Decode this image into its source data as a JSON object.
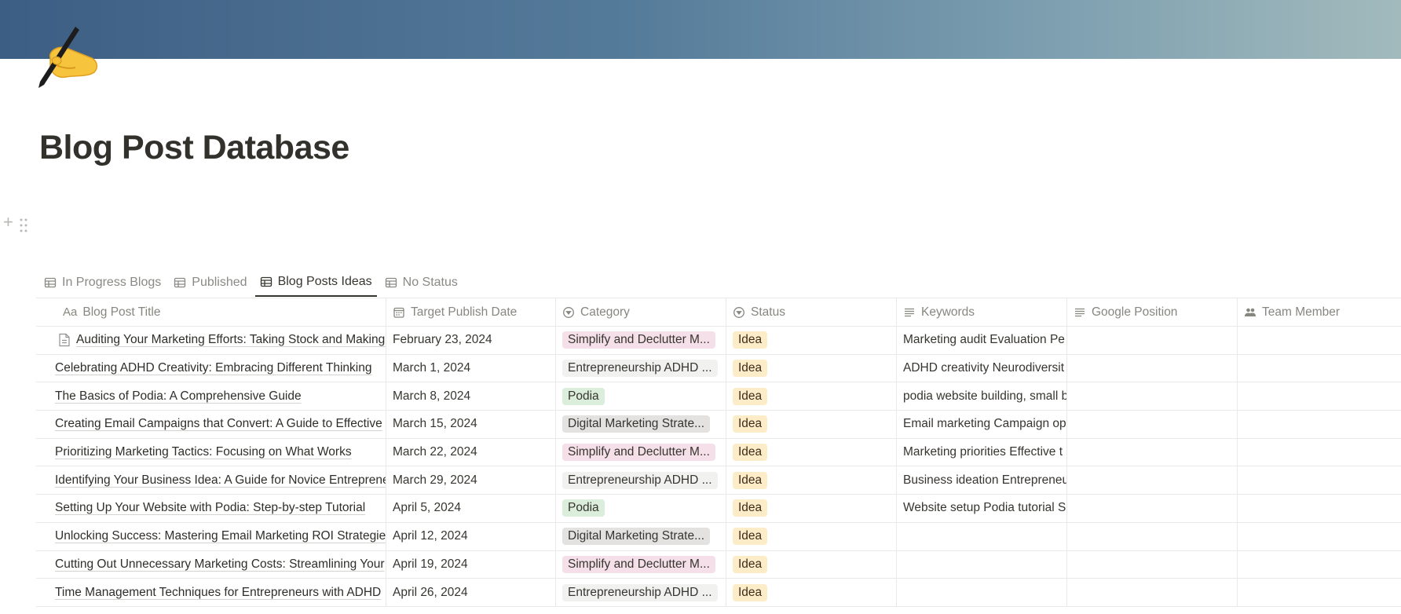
{
  "page": {
    "title": "Blog Post Database",
    "icon": "writing-hand-icon"
  },
  "tabs": [
    {
      "label": "In Progress Blogs",
      "active": false
    },
    {
      "label": "Published",
      "active": false
    },
    {
      "label": "Blog Posts Ideas",
      "active": true
    },
    {
      "label": "No Status",
      "active": false
    }
  ],
  "columns": [
    "Blog Post Title",
    "Target Publish Date",
    "Category",
    "Status",
    "Keywords",
    "Google Position",
    "Team Member"
  ],
  "category_colors": {
    "Simplify and Declutter M...": "#f5e0e9",
    "Entrepreneurship ADHD ...": "#f1f1ef",
    "Podia": "#dbeddb",
    "Digital Marketing Strate...": "#e3e2e0"
  },
  "status_color": "#fdecc8",
  "rows": [
    {
      "title": "Auditing Your Marketing Efforts: Taking Stock and Making Changes",
      "date": "February 23, 2024",
      "category": "Simplify and Declutter M...",
      "status": "Idea",
      "keywords": "Marketing audit Evaluation Pe"
    },
    {
      "title": "Celebrating ADHD Creativity: Embracing Different Thinking",
      "date": "March 1, 2024",
      "category": "Entrepreneurship ADHD ...",
      "status": "Idea",
      "keywords": "ADHD creativity Neurodiversit"
    },
    {
      "title": "The Basics of Podia: A Comprehensive Guide",
      "date": "March 8, 2024",
      "category": "Podia",
      "status": "Idea",
      "keywords": "podia website building, small b"
    },
    {
      "title": "Creating Email Campaigns that Convert: A Guide to Effective",
      "date": "March 15, 2024",
      "category": "Digital Marketing Strate...",
      "status": "Idea",
      "keywords": "Email marketing Campaign op"
    },
    {
      "title": "Prioritizing Marketing Tactics: Focusing on What Works",
      "date": "March 22, 2024",
      "category": "Simplify and Declutter M...",
      "status": "Idea",
      "keywords": "Marketing priorities Effective t"
    },
    {
      "title": "Identifying Your Business Idea: A Guide for Novice Entrepreneurs",
      "date": "March 29, 2024",
      "category": "Entrepreneurship ADHD ...",
      "status": "Idea",
      "keywords": "Business ideation Entrepreneu"
    },
    {
      "title": "Setting Up Your Website with Podia: Step-by-step Tutorial",
      "date": "April 5, 2024",
      "category": "Podia",
      "status": "Idea",
      "keywords": "Website setup Podia tutorial S"
    },
    {
      "title": "Unlocking Success: Mastering Email Marketing ROI Strategies",
      "date": "April 12, 2024",
      "category": "Digital Marketing Strate...",
      "status": "Idea",
      "keywords": ""
    },
    {
      "title": "Cutting Out Unnecessary Marketing Costs: Streamlining Your",
      "date": "April 19, 2024",
      "category": "Simplify and Declutter M...",
      "status": "Idea",
      "keywords": ""
    },
    {
      "title": "Time Management Techniques for Entrepreneurs with ADHD",
      "date": "April 26, 2024",
      "category": "Entrepreneurship ADHD ...",
      "status": "Idea",
      "keywords": ""
    }
  ]
}
